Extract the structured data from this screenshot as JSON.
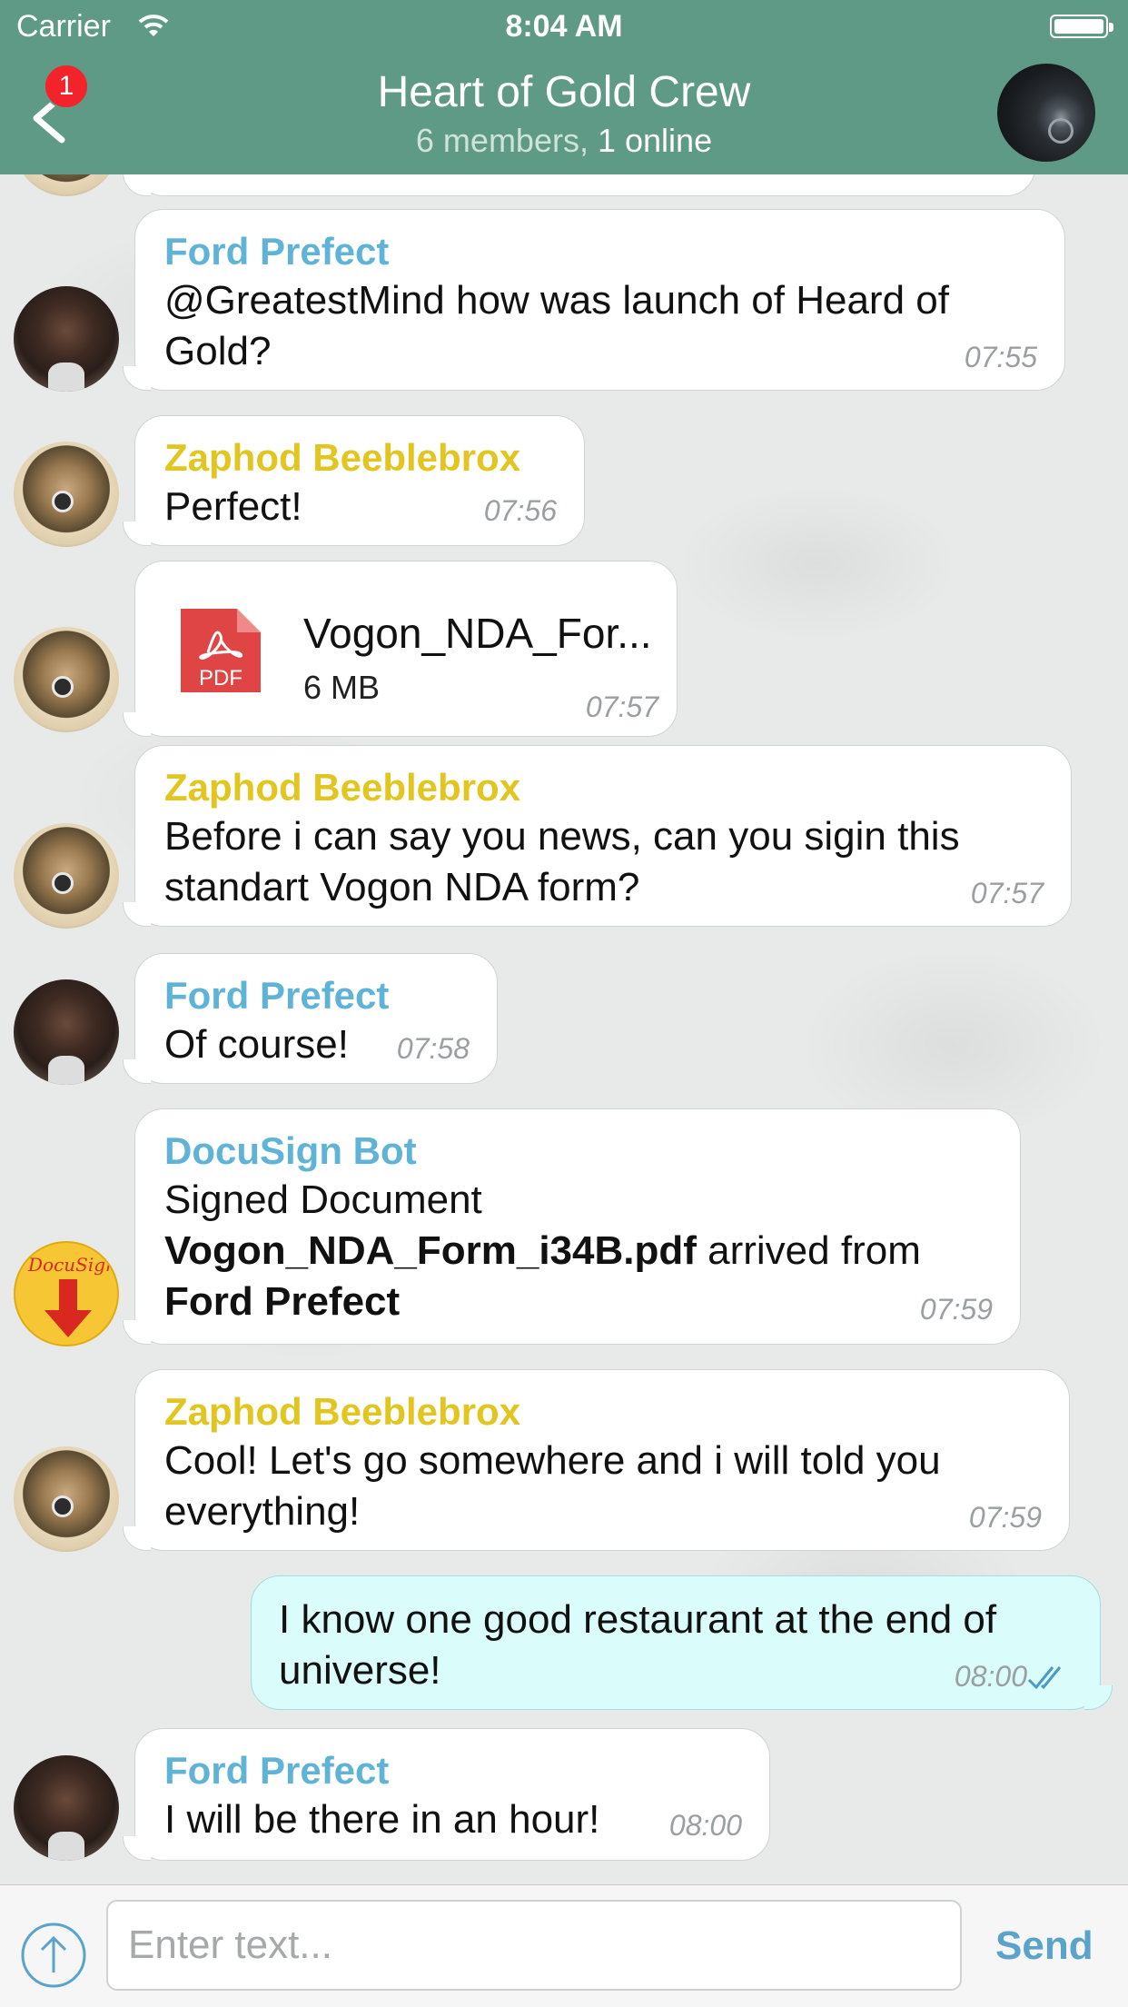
{
  "status_bar": {
    "carrier": "Carrier",
    "time": "8:04 AM"
  },
  "header": {
    "back_badge": "1",
    "title": "Heart of Gold Crew",
    "subtitle_members": "6 members,",
    "subtitle_online": "1 online"
  },
  "messages": [
    {
      "sender": "Ford Prefect",
      "lines": [
        "@GreatestMind how was launch of Heard of",
        "Gold?"
      ],
      "time": "07:55"
    },
    {
      "sender": "Zaphod Beeblebrox",
      "lines": [
        "Perfect!"
      ],
      "time": "07:56"
    },
    {
      "file_name": "Vogon_NDA_For...",
      "file_size": "6 MB",
      "file_type": "PDF",
      "time": "07:57"
    },
    {
      "sender": "Zaphod Beeblebrox",
      "lines": [
        "Before i can say you news, can you sigin this",
        "standart Vogon NDA form?"
      ],
      "time": "07:57"
    },
    {
      "sender": "Ford Prefect",
      "lines": [
        "Of course!"
      ],
      "time": "07:58"
    },
    {
      "sender": "DocuSign Bot",
      "line1": "Signed Document",
      "doc_name": "Vogon_NDA_Form_i34B.pdf",
      "line2_rest": " arrived from",
      "line3": "Ford Prefect",
      "avatar_text": "DocuSign",
      "time": "07:59"
    },
    {
      "sender": "Zaphod Beeblebrox",
      "lines": [
        "Cool! Let's go somewhere and i will told you",
        "everything!"
      ],
      "time": "07:59"
    },
    {
      "lines": [
        "I know one good restaurant at the end of",
        "universe!"
      ],
      "time": "08:00"
    },
    {
      "sender": "Ford Prefect",
      "lines": [
        "I will be there in an hour!"
      ],
      "time": "08:00"
    }
  ],
  "composer": {
    "placeholder": "Enter text...",
    "send_label": "Send"
  },
  "colors": {
    "header": "#5e9a85",
    "ford": "#5fb3d6",
    "zaphod": "#e2c51e",
    "outgoing_bubble": "#dafcfb",
    "send": "#5aa4cc",
    "pdf": "#e04545"
  }
}
